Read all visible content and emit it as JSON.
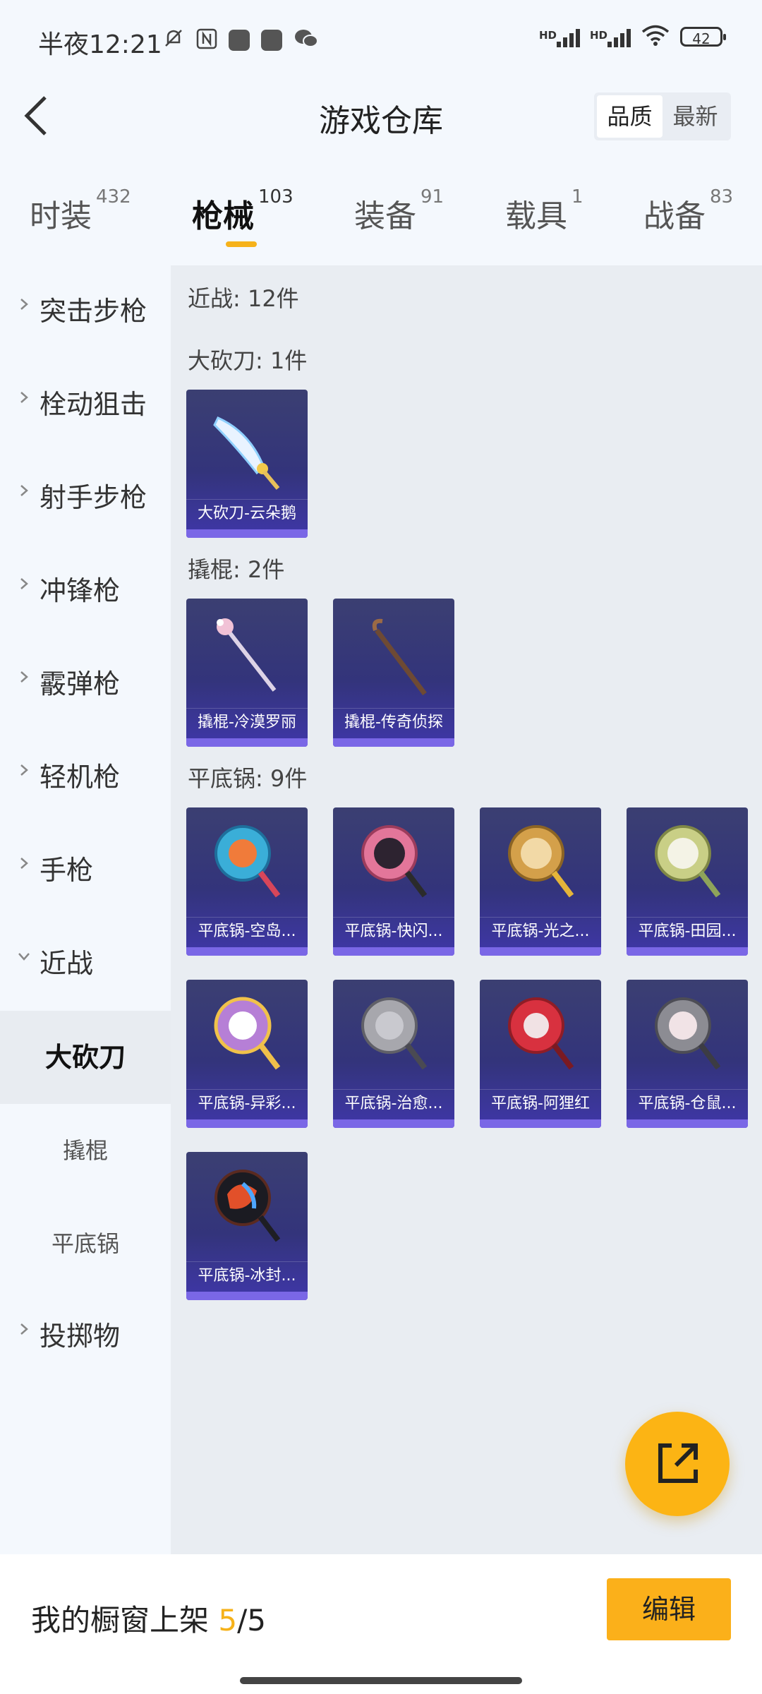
{
  "status_bar": {
    "time": "半夜12:21",
    "battery": "42",
    "icons": [
      "bell-off-icon",
      "nfc-icon",
      "app-icon",
      "app-icon",
      "wechat-icon",
      "signal-hd-icon",
      "signal-hd-icon",
      "wifi-icon",
      "battery-icon"
    ]
  },
  "header": {
    "title": "游戏仓库",
    "sort_options": [
      "品质",
      "最新"
    ],
    "sort_selected": "品质"
  },
  "tabs": [
    {
      "label": "时装",
      "count": "432"
    },
    {
      "label": "枪械",
      "count": "103"
    },
    {
      "label": "装备",
      "count": "91"
    },
    {
      "label": "载具",
      "count": "1"
    },
    {
      "label": "战备",
      "count": "83"
    }
  ],
  "active_tab": "枪械",
  "sidebar": {
    "categories": [
      "突击步枪",
      "栓动狙击",
      "射手步枪",
      "冲锋枪",
      "霰弹枪",
      "轻机枪",
      "手枪",
      "近战"
    ],
    "melee_subitems": [
      "大砍刀",
      "撬棍",
      "平底锅"
    ],
    "active_subitem": "大砍刀",
    "last_category": "投掷物"
  },
  "content": {
    "summary": "近战: 12件",
    "sections": [
      {
        "title": "大砍刀: 1件",
        "items": [
          "大砍刀-云朵鹅"
        ]
      },
      {
        "title": "撬棍: 2件",
        "items": [
          "撬棍-冷漠罗丽",
          "撬棍-传奇侦探"
        ]
      },
      {
        "title": "平底锅: 9件",
        "items": [
          "平底锅-空岛...",
          "平底锅-快闪...",
          "平底锅-光之...",
          "平底锅-田园...",
          "平底锅-异彩...",
          "平底锅-治愈...",
          "平底锅-阿狸红",
          "平底锅-仓鼠...",
          "平底锅-冰封..."
        ]
      }
    ]
  },
  "bottom": {
    "showcase_label": "我的橱窗上架",
    "showcase_current": "5",
    "showcase_total": "/5",
    "edit_label": "编辑"
  },
  "colors": {
    "accent": "#fbb01a",
    "card_bg": "#36367a",
    "card_glow": "#7a67e6"
  }
}
